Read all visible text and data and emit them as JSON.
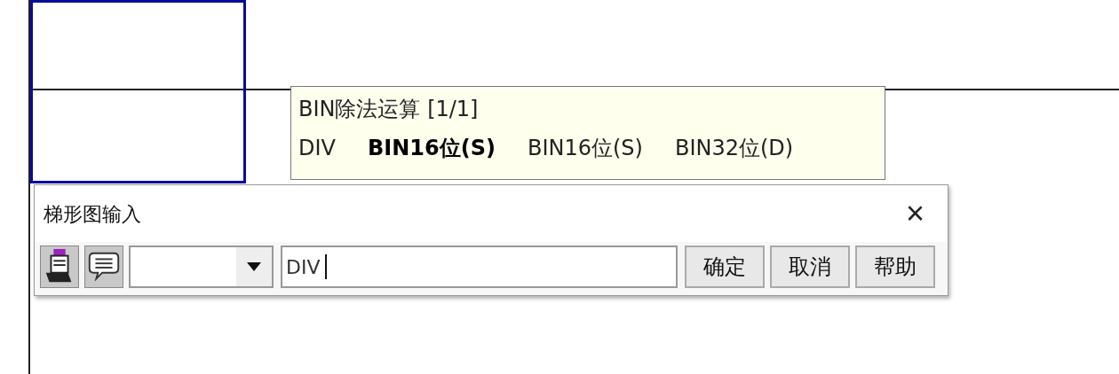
{
  "tooltip": {
    "title": "BIN除法运算 [1/1]",
    "items": [
      {
        "label": "DIV",
        "selected": false
      },
      {
        "label": "BIN16位(S)",
        "selected": true
      },
      {
        "label": "BIN16位(S)",
        "selected": false
      },
      {
        "label": "BIN32位(D)",
        "selected": false
      }
    ]
  },
  "dialog": {
    "title": "梯形图输入",
    "close": "×",
    "input": {
      "value": "DIV"
    },
    "buttons": [
      "确定",
      "取消",
      "帮助"
    ]
  }
}
